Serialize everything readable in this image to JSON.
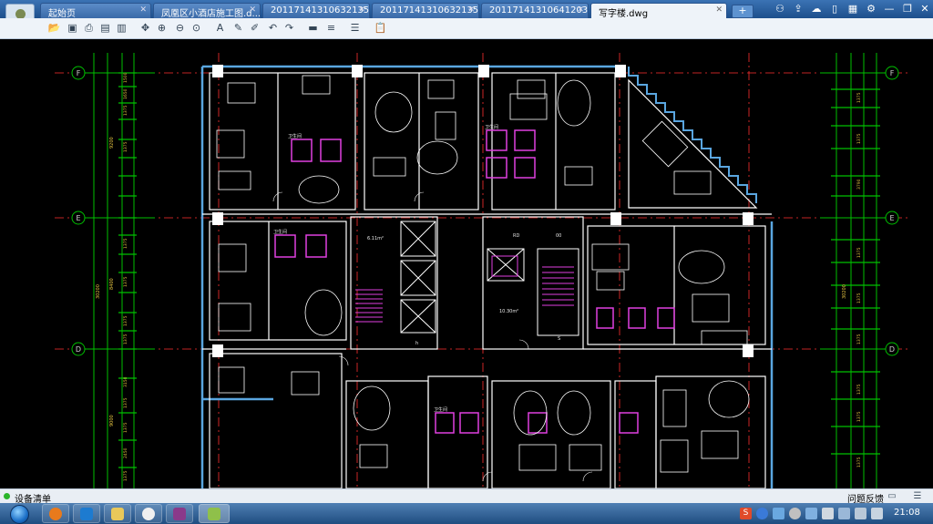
{
  "tabs": [
    {
      "label": "起始页",
      "active": false
    },
    {
      "label": "凤凰区小酒店施工图.d...",
      "active": false
    },
    {
      "label": "20117141310632135...",
      "active": false
    },
    {
      "label": "20117141310632135...",
      "active": false
    },
    {
      "label": "20117141310641203...",
      "active": false
    },
    {
      "label": "写字楼.dwg",
      "active": true
    }
  ],
  "new_tab_label": "+",
  "window_controls": [
    "user-icon",
    "share-icon",
    "cloud-icon",
    "mobile-icon",
    "settings-icon",
    "minimize-icon",
    "restore-icon",
    "close-icon"
  ],
  "toolbar_icons": [
    "open-icon",
    "save-icon",
    "print-icon",
    "export-pdf-icon",
    "batch-print-icon",
    "pan-icon",
    "zoom-icon",
    "zoom-window-icon",
    "zoom-extent-icon",
    "text-icon",
    "pencil-icon",
    "markup-icon",
    "undo-icon",
    "redo-icon",
    "measure-icon",
    "layers-icon",
    "clipboard-icon"
  ],
  "drawing": {
    "grid_labels_left": [
      "F",
      "E",
      "D"
    ],
    "grid_labels_right": [
      "F",
      "E",
      "D"
    ],
    "dim_left_outer": [
      "30200",
      "9200",
      "8400",
      "9000"
    ],
    "dim_left_inner": [
      "1500",
      "1650",
      "1375",
      "1375",
      "1375",
      "1375",
      "1375",
      "1375",
      "3150",
      "1375",
      "1375",
      "2450",
      "1375"
    ],
    "dim_right_outer": [
      "30200"
    ],
    "dim_right_inner": [
      "1375",
      "1375",
      "3790",
      "1375",
      "1375",
      "1375",
      "1375",
      "1375",
      "1375"
    ],
    "room_labels": [
      "卫生间",
      "卫生间",
      "卫生间",
      "卫生间",
      "RD",
      "00",
      "S",
      "h"
    ],
    "area_labels": [
      "6.11m²",
      "10.30m²"
    ]
  },
  "status": {
    "text": "设备清单",
    "feedback_label": "问题反馈"
  },
  "taskbar": {
    "clock": "21:08",
    "tray_badge": "S"
  },
  "colors": {
    "cad_background": "#000000",
    "walls": "#ffffff",
    "outer_wall": "#5aa6e0",
    "grid_axis": "#ff3030",
    "dimension": "#00c000",
    "fixtures": "#e040e0"
  }
}
